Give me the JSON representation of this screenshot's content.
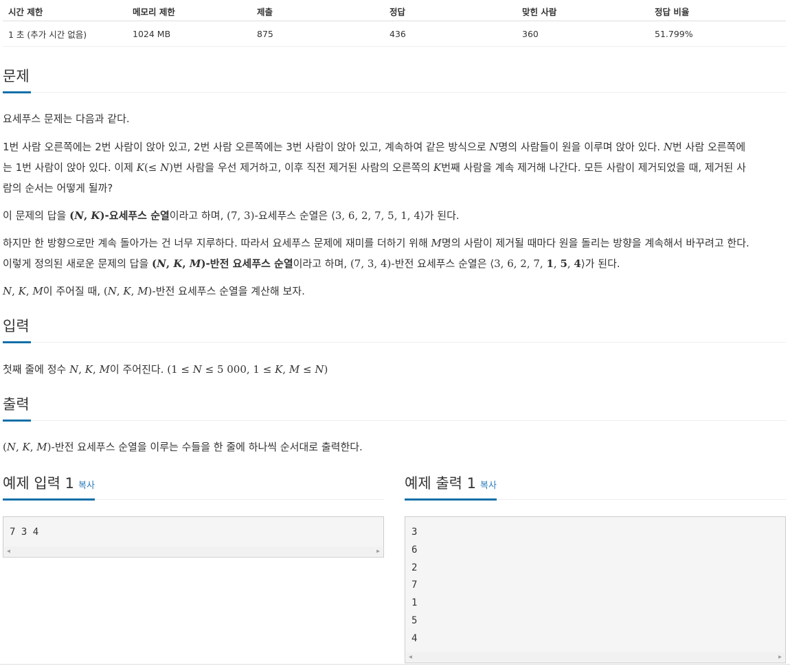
{
  "stats": {
    "headers": [
      "시간 제한",
      "메모리 제한",
      "제출",
      "정답",
      "맞힌 사람",
      "정답 비율"
    ],
    "values": [
      "1 초 (추가 시간 없음)",
      "1024 MB",
      "875",
      "436",
      "360",
      "51.799%"
    ]
  },
  "sections": {
    "problem_title": "문제",
    "input_title": "입력",
    "output_title": "출력"
  },
  "problem": {
    "p1": "요세푸스 문제는 다음과 같다.",
    "p2_a": "1번 사람 오른쪽에는 2번 사람이 앉아 있고, 2번 사람 오른쪽에는 3번 사람이 앉아 있고, 계속하여 같은 방식으로 ",
    "p2_b": "명의 사람들이 원을 이루며 앉아 있다. ",
    "p2_c": "번 사람 오른쪽에",
    "p2_d": "는 1번 사람이 앉아 있다. 이제 ",
    "p2_e": "번 사람을 우선 제거하고, 이후 직전 제거된 사람의 오른쪽의 ",
    "p2_f": "번째 사람을 계속 제거해 나간다. 모든 사람이 제거되었을 때, 제거된 사",
    "p2_g": "람의 순서는 어떻게 될까?",
    "p3_a": "이 문제의 답을 ",
    "p3_b": "-요세푸스 순열",
    "p3_c": "이라고 하며, ",
    "p3_d": "-요세푸스 순열은 ",
    "p3_e": "가 된다.",
    "p4_a": "하지만 한 방향으로만 계속 돌아가는 건 너무 지루하다. 따라서 요세푸스 문제에 재미를 더하기 위해 ",
    "p4_b": "명의 사람이 제거될 때마다 원을 돌리는 방향을 계속해서 바꾸려고 한다.",
    "p4_c": "이렇게 정의된 새로운 문제의 답을 ",
    "p4_d": "-반전 요세푸스 순열",
    "p4_e": "이라고 하며, ",
    "p4_f": "-반전 요세푸스 순열은 ",
    "p4_g": "가 된다.",
    "p5_a": "이 주어질 때, ",
    "p5_b": "-반전 요세푸스 순열을 계산해 보자."
  },
  "input": {
    "a": "첫째 줄에 정수 ",
    "b": "이 주어진다. "
  },
  "output": {
    "a": "-반전 요세푸스 순열을 이루는 수들을 한 줄에 하나씩 순서대로 출력한다."
  },
  "examples": {
    "input_title": "예제 입력 1",
    "output_title": "예제 출력 1",
    "copy_label": "복사",
    "input_text": "7 3 4",
    "output_text": "3\n6\n2\n7\n1\n5\n4"
  }
}
